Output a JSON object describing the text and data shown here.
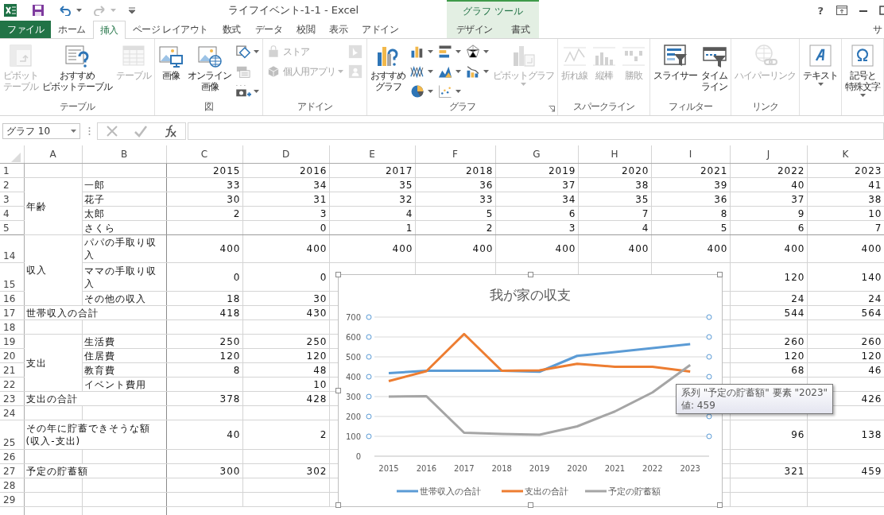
{
  "window": {
    "title": "ライフイベント-1-1 - Excel",
    "help": "?",
    "account": "サ"
  },
  "tabs": [
    {
      "label": "ファイル",
      "kind": "file",
      "selected": false
    },
    {
      "label": "ホーム",
      "kind": "tab",
      "selected": false
    },
    {
      "label": "挿入",
      "kind": "tab",
      "selected": true
    },
    {
      "label": "ページ レイアウト",
      "kind": "tab",
      "selected": false
    },
    {
      "label": "数式",
      "kind": "tab",
      "selected": false
    },
    {
      "label": "データ",
      "kind": "tab",
      "selected": false
    },
    {
      "label": "校閲",
      "kind": "tab",
      "selected": false
    },
    {
      "label": "表示",
      "kind": "tab",
      "selected": false
    },
    {
      "label": "アドイン",
      "kind": "tab",
      "selected": false
    }
  ],
  "contextual_tabs": {
    "header": "グラフ ツール",
    "tabs": [
      {
        "label": "デザイン",
        "selected": false
      },
      {
        "label": "書式",
        "selected": false
      }
    ]
  },
  "ribbon": {
    "groups": [
      {
        "label": "テーブル",
        "items": [
          {
            "kind": "large",
            "lines": [
              "ピボット",
              "テーブル"
            ],
            "disabled": true
          },
          {
            "kind": "large",
            "lines": [
              "おすすめ",
              "ピボットテーブル"
            ],
            "disabled": false
          },
          {
            "kind": "large",
            "lines": [
              "テーブル"
            ],
            "disabled": true
          }
        ]
      },
      {
        "label": "図",
        "items": [
          {
            "kind": "large",
            "lines": [
              "画像"
            ],
            "disabled": false
          },
          {
            "kind": "large",
            "lines": [
              "オンライン",
              "画像"
            ],
            "disabled": false
          },
          {
            "kind": "stack",
            "items": [
              {
                "kind": "small",
                "disabled": false,
                "dropdown": true
              },
              {
                "kind": "small",
                "disabled": false
              },
              {
                "kind": "small",
                "disabled": false,
                "dropdown": true
              }
            ]
          }
        ]
      },
      {
        "label": "アドイン",
        "items": [
          {
            "kind": "stack",
            "items": [
              {
                "kind": "small",
                "label": "ストア",
                "disabled": true
              },
              {
                "kind": "small",
                "label": "個人用アプリ",
                "disabled": true,
                "dropdown": true
              }
            ]
          },
          {
            "kind": "stack",
            "items": [
              {
                "kind": "small",
                "disabled": true
              },
              {
                "kind": "small",
                "disabled": true
              }
            ]
          }
        ]
      },
      {
        "label": "グラフ",
        "dialog_launcher": true,
        "items": [
          {
            "kind": "large",
            "lines": [
              "おすすめ",
              "グラフ"
            ],
            "disabled": false
          },
          {
            "kind": "stack",
            "items": [
              {
                "kind": "small",
                "disabled": false,
                "dropdown": true
              },
              {
                "kind": "small",
                "disabled": false,
                "dropdown": true
              },
              {
                "kind": "small",
                "disabled": false,
                "dropdown": true
              }
            ]
          },
          {
            "kind": "stack",
            "items": [
              {
                "kind": "small",
                "disabled": false,
                "dropdown": true
              },
              {
                "kind": "small",
                "disabled": false,
                "dropdown": true
              },
              {
                "kind": "small",
                "disabled": false,
                "dropdown": true
              }
            ]
          },
          {
            "kind": "stack",
            "items": [
              {
                "kind": "small",
                "disabled": false,
                "dropdown": true
              },
              {
                "kind": "small",
                "disabled": false,
                "dropdown": true
              }
            ]
          },
          {
            "kind": "large",
            "lines": [
              "ピボットグラフ"
            ],
            "disabled": true,
            "dropdown": true
          }
        ]
      },
      {
        "label": "スパークライン",
        "items": [
          {
            "kind": "large",
            "lines": [
              "折れ線"
            ],
            "disabled": true
          },
          {
            "kind": "large",
            "lines": [
              "縦棒"
            ],
            "disabled": true
          },
          {
            "kind": "large",
            "lines": [
              "勝敗"
            ],
            "disabled": true
          }
        ]
      },
      {
        "label": "フィルター",
        "items": [
          {
            "kind": "large",
            "lines": [
              "スライサー"
            ],
            "disabled": false
          },
          {
            "kind": "large",
            "lines": [
              "タイム",
              "ライン"
            ],
            "disabled": false
          }
        ]
      },
      {
        "label": "リンク",
        "items": [
          {
            "kind": "large",
            "lines": [
              "ハイパーリンク"
            ],
            "disabled": true
          }
        ]
      },
      {
        "items": [
          {
            "kind": "large",
            "lines": [
              "テキスト"
            ],
            "disabled": false,
            "dropdown": true
          }
        ]
      },
      {
        "items": [
          {
            "kind": "large",
            "lines": [
              "記号と",
              "特殊文字"
            ],
            "disabled": false,
            "dropdown": true
          }
        ]
      }
    ]
  },
  "formula_bar": {
    "name_box": "グラフ 10"
  },
  "sheet": {
    "columns": [
      "A",
      "B",
      "C",
      "D",
      "E",
      "F",
      "G",
      "H",
      "I",
      "J",
      "K"
    ],
    "rows": [
      {
        "number": "1",
        "cells": [
          null,
          null,
          {
            "text": "2015",
            "kind": "number"
          },
          {
            "text": "2016",
            "kind": "number"
          },
          {
            "text": "2017",
            "kind": "number"
          },
          {
            "text": "2018",
            "kind": "number"
          },
          {
            "text": "2019",
            "kind": "number"
          },
          {
            "text": "2020",
            "kind": "number"
          },
          {
            "text": "2021",
            "kind": "number"
          },
          {
            "text": "2022",
            "kind": "number"
          },
          {
            "text": "2023",
            "kind": "number"
          }
        ]
      },
      {
        "number": "2",
        "cells": [
          {
            "text": "年齢",
            "kind": "label",
            "rowspan": 4
          },
          {
            "text": "一郎",
            "kind": "label"
          },
          {
            "text": "33",
            "kind": "number"
          },
          {
            "text": "34",
            "kind": "number"
          },
          {
            "text": "35",
            "kind": "number"
          },
          {
            "text": "36",
            "kind": "number"
          },
          {
            "text": "37",
            "kind": "number"
          },
          {
            "text": "38",
            "kind": "number"
          },
          {
            "text": "39",
            "kind": "number"
          },
          {
            "text": "40",
            "kind": "number"
          },
          {
            "text": "41",
            "kind": "number"
          }
        ]
      },
      {
        "number": "3",
        "cells": [
          {
            "text": "花子",
            "kind": "label"
          },
          {
            "text": "30",
            "kind": "number"
          },
          {
            "text": "31",
            "kind": "number"
          },
          {
            "text": "32",
            "kind": "number"
          },
          {
            "text": "33",
            "kind": "number"
          },
          {
            "text": "34",
            "kind": "number"
          },
          {
            "text": "35",
            "kind": "number"
          },
          {
            "text": "36",
            "kind": "number"
          },
          {
            "text": "37",
            "kind": "number"
          },
          {
            "text": "38",
            "kind": "number"
          }
        ]
      },
      {
        "number": "4",
        "cells": [
          {
            "text": "太郎",
            "kind": "label"
          },
          {
            "text": "2",
            "kind": "number"
          },
          {
            "text": "3",
            "kind": "number"
          },
          {
            "text": "4",
            "kind": "number"
          },
          {
            "text": "5",
            "kind": "number"
          },
          {
            "text": "6",
            "kind": "number"
          },
          {
            "text": "7",
            "kind": "number"
          },
          {
            "text": "8",
            "kind": "number"
          },
          {
            "text": "9",
            "kind": "number"
          },
          {
            "text": "10",
            "kind": "number"
          }
        ]
      },
      {
        "number": "5",
        "cells": [
          {
            "text": "さくら",
            "kind": "label"
          },
          null,
          {
            "text": "0",
            "kind": "number"
          },
          {
            "text": "1",
            "kind": "number"
          },
          {
            "text": "2",
            "kind": "number"
          },
          {
            "text": "3",
            "kind": "number"
          },
          {
            "text": "4",
            "kind": "number"
          },
          {
            "text": "5",
            "kind": "number"
          },
          {
            "text": "6",
            "kind": "number"
          },
          {
            "text": "7",
            "kind": "number"
          }
        ]
      },
      {
        "number": "14",
        "cells": [
          {
            "text": "収入",
            "kind": "label",
            "rowspan": 3
          },
          {
            "text": "パパの手取り収入",
            "kind": "label"
          },
          {
            "text": "400",
            "kind": "number"
          },
          {
            "text": "400",
            "kind": "number"
          },
          {
            "text": "400",
            "kind": "number"
          },
          {
            "text": "400",
            "kind": "number"
          },
          {
            "text": "400",
            "kind": "number"
          },
          {
            "text": "400",
            "kind": "number"
          },
          {
            "text": "400",
            "kind": "number"
          },
          {
            "text": "400",
            "kind": "number"
          },
          {
            "text": "400",
            "kind": "number"
          }
        ]
      },
      {
        "number": "15",
        "cells": [
          {
            "text": "ママの手取り収入",
            "kind": "label"
          },
          {
            "text": "0",
            "kind": "number"
          },
          {
            "text": "0",
            "kind": "number"
          },
          null,
          null,
          null,
          null,
          null,
          {
            "text": "120",
            "kind": "number"
          },
          {
            "text": "140",
            "kind": "number"
          }
        ]
      },
      {
        "number": "16",
        "cells": [
          {
            "text": "その他の収入",
            "kind": "label"
          },
          {
            "text": "18",
            "kind": "number"
          },
          {
            "text": "30",
            "kind": "number"
          },
          null,
          null,
          null,
          null,
          null,
          {
            "text": "24",
            "kind": "number"
          },
          {
            "text": "24",
            "kind": "number"
          }
        ]
      },
      {
        "number": "17",
        "cells": [
          {
            "text": "世帯収入の合計",
            "kind": "label",
            "colspan": 2
          },
          {
            "text": "418",
            "kind": "number"
          },
          {
            "text": "430",
            "kind": "number"
          },
          null,
          null,
          null,
          null,
          null,
          {
            "text": "544",
            "kind": "number"
          },
          {
            "text": "564",
            "kind": "number"
          }
        ]
      },
      {
        "number": "18",
        "cells": [
          null,
          null,
          null,
          null,
          null,
          null,
          null,
          null,
          null,
          null,
          null
        ]
      },
      {
        "number": "19",
        "cells": [
          {
            "text": "支出",
            "kind": "label",
            "rowspan": 4
          },
          {
            "text": "生活費",
            "kind": "label"
          },
          {
            "text": "250",
            "kind": "number"
          },
          {
            "text": "250",
            "kind": "number"
          },
          null,
          null,
          null,
          null,
          null,
          {
            "text": "260",
            "kind": "number"
          },
          {
            "text": "260",
            "kind": "number"
          }
        ]
      },
      {
        "number": "20",
        "cells": [
          {
            "text": "住居費",
            "kind": "label"
          },
          {
            "text": "120",
            "kind": "number"
          },
          {
            "text": "120",
            "kind": "number"
          },
          null,
          null,
          null,
          null,
          null,
          {
            "text": "120",
            "kind": "number"
          },
          {
            "text": "120",
            "kind": "number"
          }
        ]
      },
      {
        "number": "21",
        "cells": [
          {
            "text": "教育費",
            "kind": "label"
          },
          {
            "text": "8",
            "kind": "number"
          },
          {
            "text": "48",
            "kind": "number"
          },
          null,
          null,
          null,
          null,
          null,
          {
            "text": "68",
            "kind": "number"
          },
          {
            "text": "46",
            "kind": "number"
          }
        ]
      },
      {
        "number": "22",
        "cells": [
          {
            "text": "イベント費用",
            "kind": "label"
          },
          null,
          {
            "text": "10",
            "kind": "number"
          },
          null,
          null,
          null,
          null,
          null,
          null,
          null
        ]
      },
      {
        "number": "23",
        "cells": [
          {
            "text": "支出の合計",
            "kind": "label",
            "colspan": 2
          },
          {
            "text": "378",
            "kind": "number"
          },
          {
            "text": "428",
            "kind": "number"
          },
          null,
          null,
          null,
          null,
          null,
          null,
          {
            "text": "426",
            "kind": "number"
          }
        ]
      },
      {
        "number": "24",
        "cells": [
          null,
          null,
          null,
          null,
          null,
          null,
          null,
          null,
          null,
          null,
          null
        ]
      },
      {
        "number": "25",
        "cells": [
          {
            "text": "その年に貯蓄できそうな額\n(収入-支出)",
            "kind": "label",
            "colspan": 2
          },
          {
            "text": "40",
            "kind": "number"
          },
          {
            "text": "2",
            "kind": "number"
          },
          null,
          null,
          null,
          null,
          null,
          {
            "text": "96",
            "kind": "number"
          },
          {
            "text": "138",
            "kind": "number"
          }
        ]
      },
      {
        "number": "26",
        "cells": [
          null,
          null,
          null,
          null,
          null,
          null,
          null,
          null,
          null,
          null,
          null
        ]
      },
      {
        "number": "27",
        "cells": [
          {
            "text": "予定の貯蓄額",
            "kind": "label",
            "colspan": 2
          },
          {
            "text": "300",
            "kind": "number"
          },
          {
            "text": "302",
            "kind": "number"
          },
          null,
          null,
          null,
          null,
          null,
          {
            "text": "321",
            "kind": "number"
          },
          {
            "text": "459",
            "kind": "number"
          }
        ]
      },
      {
        "number": "28",
        "cells": [
          null,
          null,
          null,
          null,
          null,
          null,
          null,
          null,
          null,
          null,
          null
        ]
      },
      {
        "number": "29",
        "cells": [
          null,
          null,
          null,
          null,
          null,
          null,
          null,
          null,
          null,
          null,
          null
        ]
      }
    ]
  },
  "chart": {
    "chart_data": {
      "type": "line",
      "title": "我が家の収支",
      "categories": [
        "2015",
        "2016",
        "2017",
        "2018",
        "2019",
        "2020",
        "2021",
        "2022",
        "2023"
      ],
      "series": [
        {
          "name": "世帯収入の合計",
          "color": "#5b9bd5",
          "values": [
            418,
            430,
            430,
            430,
            425,
            505,
            524,
            544,
            564
          ]
        },
        {
          "name": "支出の合計",
          "color": "#ed7d31",
          "values": [
            378,
            428,
            615,
            430,
            432,
            465,
            450,
            450,
            426
          ]
        },
        {
          "name": "予定の貯蓄額",
          "color": "#a5a5a5",
          "values": [
            300,
            302,
            118,
            112,
            108,
            150,
            225,
            321,
            459
          ]
        }
      ],
      "ylim": [
        0,
        700
      ],
      "yticks": [
        {
          "value": 0,
          "label": "0"
        },
        {
          "value": 100,
          "label": "100"
        },
        {
          "value": 200,
          "label": "200"
        },
        {
          "value": 300,
          "label": "300"
        },
        {
          "value": 400,
          "label": "400"
        },
        {
          "value": 500,
          "label": "500"
        },
        {
          "value": 600,
          "label": "600"
        },
        {
          "value": 700,
          "label": "700"
        }
      ],
      "grid": true,
      "legend": "bottom"
    },
    "tooltip": [
      "系列 \"予定の貯蓄額\" 要素 \"2023\"",
      "値: 459"
    ]
  }
}
